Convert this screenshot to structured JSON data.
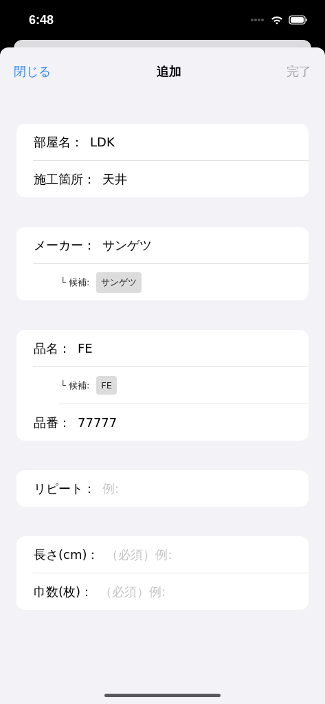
{
  "status_bar": {
    "time": "6:48"
  },
  "nav": {
    "left": "閉じる",
    "title": "追加",
    "right": "完了",
    "right_disabled": true
  },
  "sections": [
    {
      "rows": [
        {
          "kind": "field",
          "label": "部屋名：",
          "value": "LDK"
        },
        {
          "kind": "field",
          "label": "施工箇所：",
          "value": "天井"
        }
      ]
    },
    {
      "rows": [
        {
          "kind": "field",
          "label": "メーカー：",
          "value": "サンゲツ"
        },
        {
          "kind": "suggestion",
          "label": "└ 候補:",
          "chip": "サンゲツ"
        }
      ]
    },
    {
      "rows": [
        {
          "kind": "field",
          "label": "品名：",
          "value": "FE"
        },
        {
          "kind": "suggestion",
          "label": "└ 候補:",
          "chip": "FE"
        },
        {
          "kind": "field",
          "label": "品番：",
          "value": "77777"
        }
      ]
    },
    {
      "rows": [
        {
          "kind": "field",
          "label": "リピート：",
          "placeholder": "例:"
        }
      ]
    },
    {
      "rows": [
        {
          "kind": "field",
          "label": "長さ(cm)：",
          "placeholder": "（必須）例:"
        },
        {
          "kind": "field",
          "label": "巾数(枚)：",
          "placeholder": "（必須）例:"
        }
      ]
    }
  ]
}
